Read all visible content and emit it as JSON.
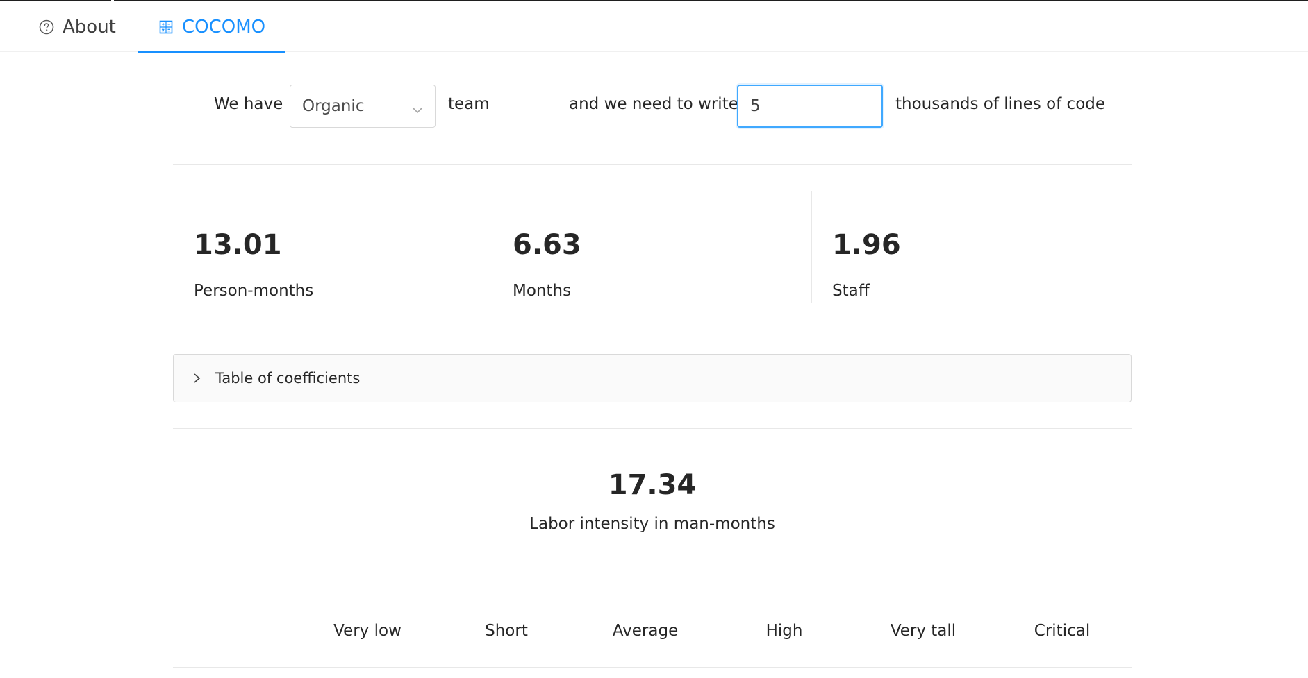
{
  "tabs": [
    {
      "label": "About",
      "icon": "question-circle-icon",
      "active": false
    },
    {
      "label": "COCOMO",
      "icon": "calculator-icon",
      "active": true
    }
  ],
  "form": {
    "prefix": "We have",
    "team_type": "Organic",
    "team_suffix": "team",
    "middle": "and we need to write",
    "kloc_value": "5",
    "suffix": "thousands of lines of code"
  },
  "stats": [
    {
      "value": "13.01",
      "label": "Person-months"
    },
    {
      "value": "6.63",
      "label": "Months"
    },
    {
      "value": "1.96",
      "label": "Staff"
    }
  ],
  "collapse": {
    "title": "Table of coefficients",
    "expanded": false
  },
  "labor": {
    "value": "17.34",
    "label": "Labor intensity in man-months"
  },
  "ratings": [
    "Very low",
    "Short",
    "Average",
    "High",
    "Very tall",
    "Critical"
  ],
  "colors": {
    "accent": "#1890ff",
    "border": "#d9d9d9",
    "divider": "#e8e8e8"
  }
}
